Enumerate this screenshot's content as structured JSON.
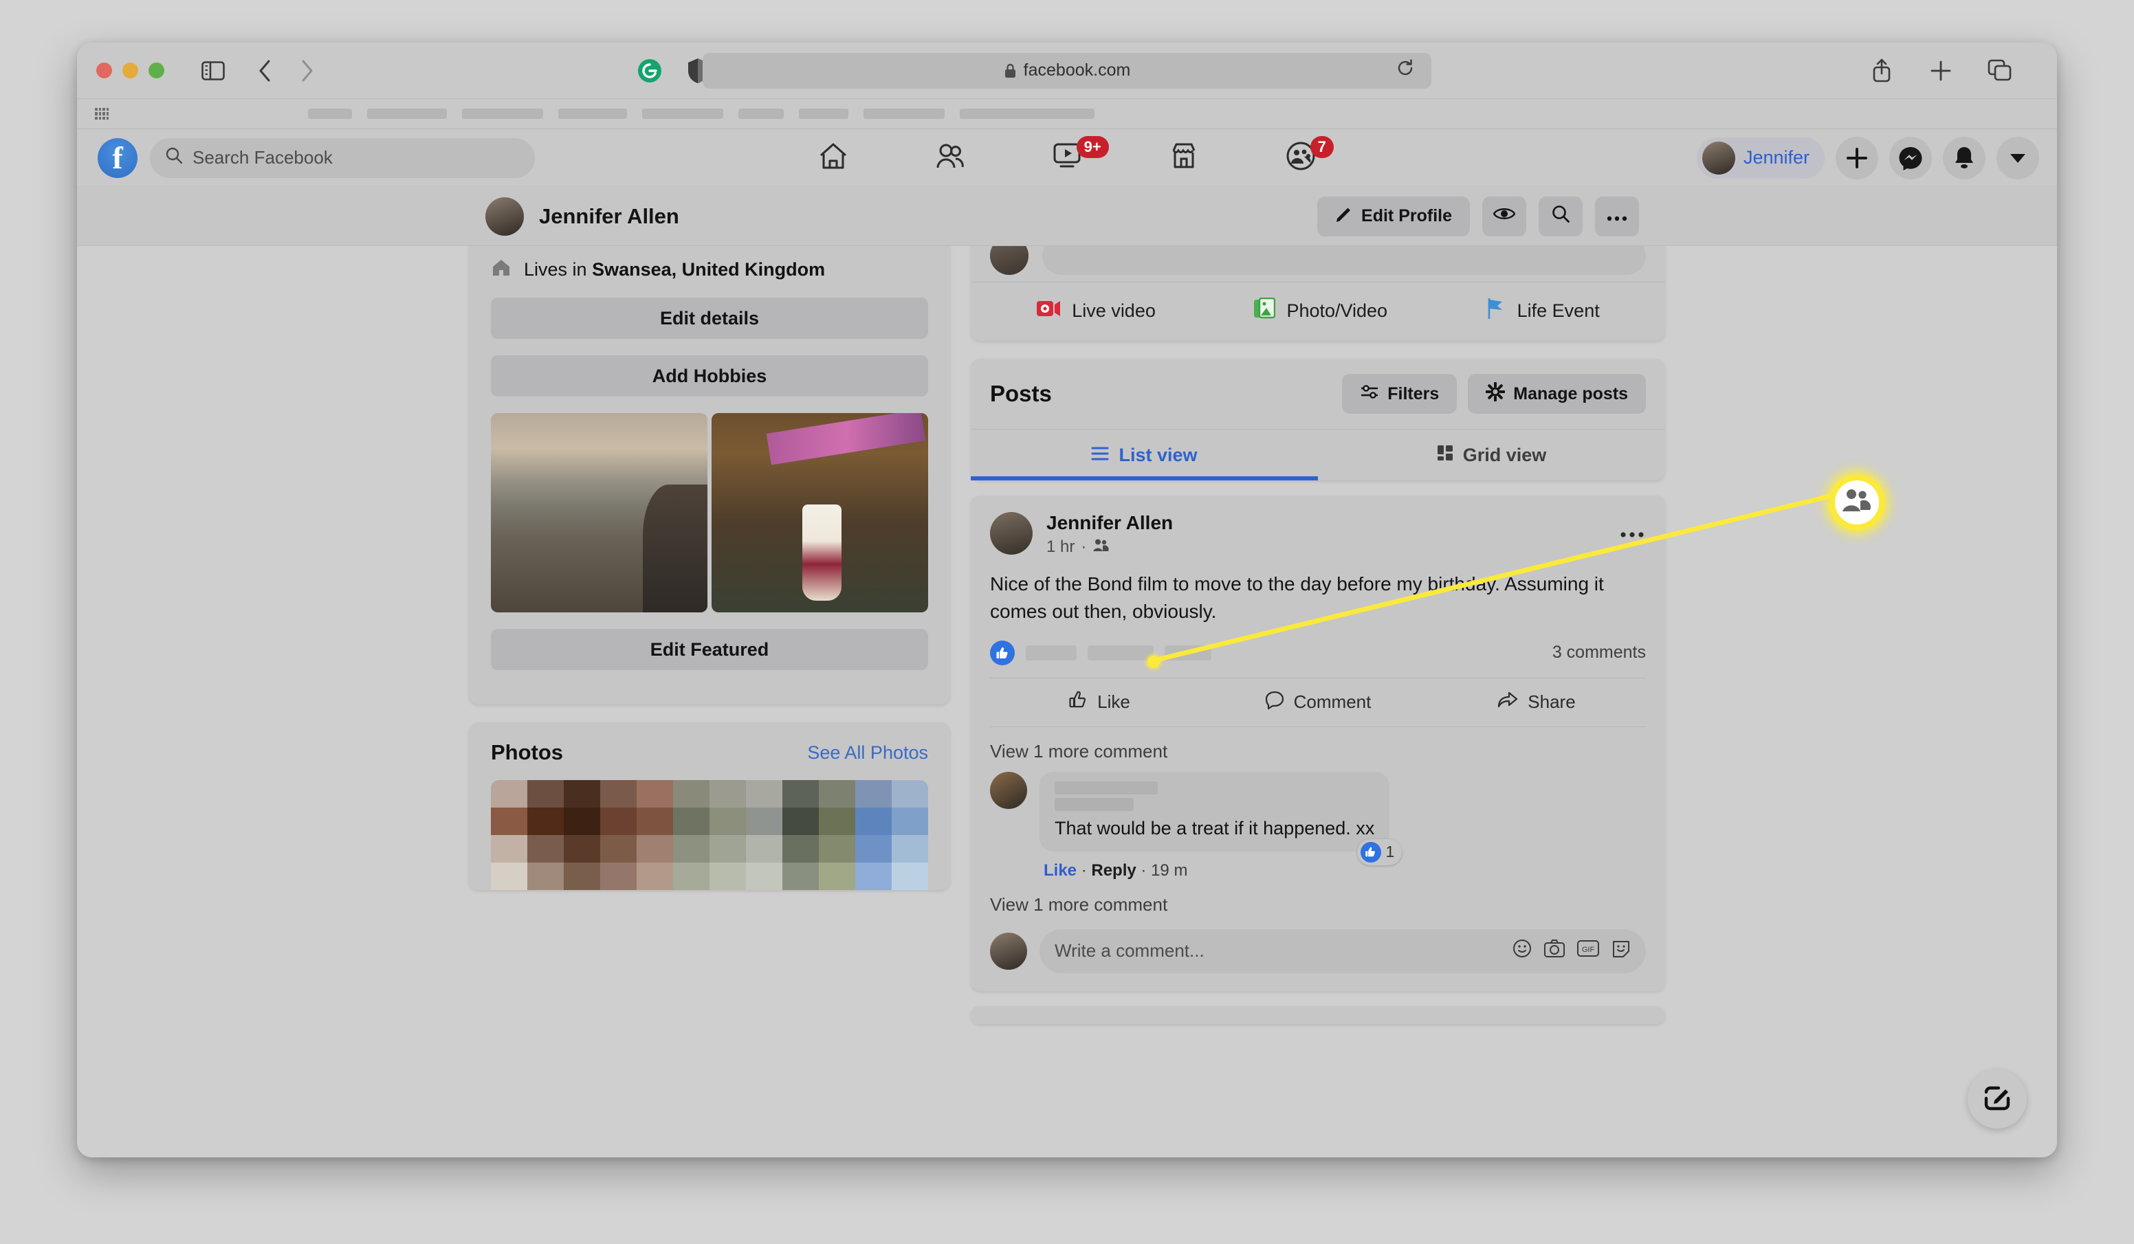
{
  "browser": {
    "url": "facebook.com",
    "lock_icon": "lock-icon",
    "reload_icon": "reload-icon",
    "sidebar_icon": "sidebar-toggle-icon",
    "back_icon": "back-arrow-icon",
    "forward_icon": "forward-arrow-icon",
    "grammarly_icon": "grammarly-icon",
    "shield_icon": "privacy-shield-icon",
    "share_icon": "share-icon",
    "new_tab_icon": "plus-icon",
    "tabs_overview_icon": "tab-overview-icon",
    "bookmarks_grid_icon": "bookmarks-grid-icon"
  },
  "fb_header": {
    "logo_letter": "f",
    "search_placeholder": "Search Facebook",
    "search_icon": "search-icon",
    "nav": [
      {
        "name": "home",
        "icon": "home-icon",
        "badge": ""
      },
      {
        "name": "friends",
        "icon": "friends-icon",
        "badge": ""
      },
      {
        "name": "watch",
        "icon": "video-icon",
        "badge": "9+"
      },
      {
        "name": "marketplace",
        "icon": "marketplace-icon",
        "badge": ""
      },
      {
        "name": "groups",
        "icon": "groups-icon",
        "badge": "7"
      }
    ],
    "user_name": "Jennifer",
    "actions": [
      {
        "name": "create",
        "icon": "plus-icon"
      },
      {
        "name": "messenger",
        "icon": "messenger-icon"
      },
      {
        "name": "notifications",
        "icon": "bell-icon"
      },
      {
        "name": "account",
        "icon": "chevron-down-icon"
      }
    ]
  },
  "profile_bar": {
    "name": "Jennifer Allen",
    "edit_profile_label": "Edit Profile",
    "edit_icon": "pencil-icon",
    "view_as_icon": "eye-icon",
    "search_icon": "search-icon",
    "more_icon": "ellipsis-icon"
  },
  "intro": {
    "lives_prefix": "Lives in ",
    "lives_place": "Swansea, United Kingdom",
    "home_icon": "home-icon",
    "edit_details_label": "Edit details",
    "add_hobbies_label": "Add Hobbies",
    "edit_featured_label": "Edit Featured"
  },
  "photos": {
    "title": "Photos",
    "see_all_label": "See All Photos"
  },
  "composer": {
    "actions": [
      {
        "label": "Live video",
        "icon": "live-video-icon",
        "color": "#d9293b"
      },
      {
        "label": "Photo/Video",
        "icon": "photo-video-icon",
        "color": "#43a047"
      },
      {
        "label": "Life Event",
        "icon": "life-event-icon",
        "color": "#3d8ed6"
      }
    ]
  },
  "posts_section": {
    "title": "Posts",
    "filters_label": "Filters",
    "filters_icon": "filters-icon",
    "manage_label": "Manage posts",
    "manage_icon": "gear-icon",
    "tabs": [
      {
        "label": "List view",
        "icon": "list-icon",
        "active": true
      },
      {
        "label": "Grid view",
        "icon": "grid-icon",
        "active": false
      }
    ]
  },
  "post": {
    "author": "Jennifer Allen",
    "time": "1 hr",
    "separator": "·",
    "audience_icon": "friends-audience-icon",
    "more_icon": "ellipsis-icon",
    "text": "Nice of the Bond film to move to the day before my birthday. Assuming it comes out then, obviously.",
    "reaction_icon": "thumbs-up-icon",
    "comments_count": "3 comments",
    "actions": [
      {
        "label": "Like",
        "icon": "thumbs-up-outline-icon"
      },
      {
        "label": "Comment",
        "icon": "comment-bubble-icon"
      },
      {
        "label": "Share",
        "icon": "share-arrow-icon"
      }
    ],
    "view_more_top": "View 1 more comment",
    "view_more_bottom": "View 1 more comment",
    "comment": {
      "text": "That would be a treat if it happened. xx",
      "like_label": "Like",
      "reply_label": "Reply",
      "time": "19 m",
      "like_count": "1",
      "like_icon": "thumbs-up-icon"
    },
    "write_placeholder": "Write a comment...",
    "write_icons": [
      "emoji-icon",
      "camera-icon",
      "gif-icon",
      "sticker-icon"
    ]
  },
  "callout": {
    "icon": "friends-audience-icon",
    "highlight_color": "#fbe93c"
  },
  "fab": {
    "icon": "compose-icon"
  }
}
